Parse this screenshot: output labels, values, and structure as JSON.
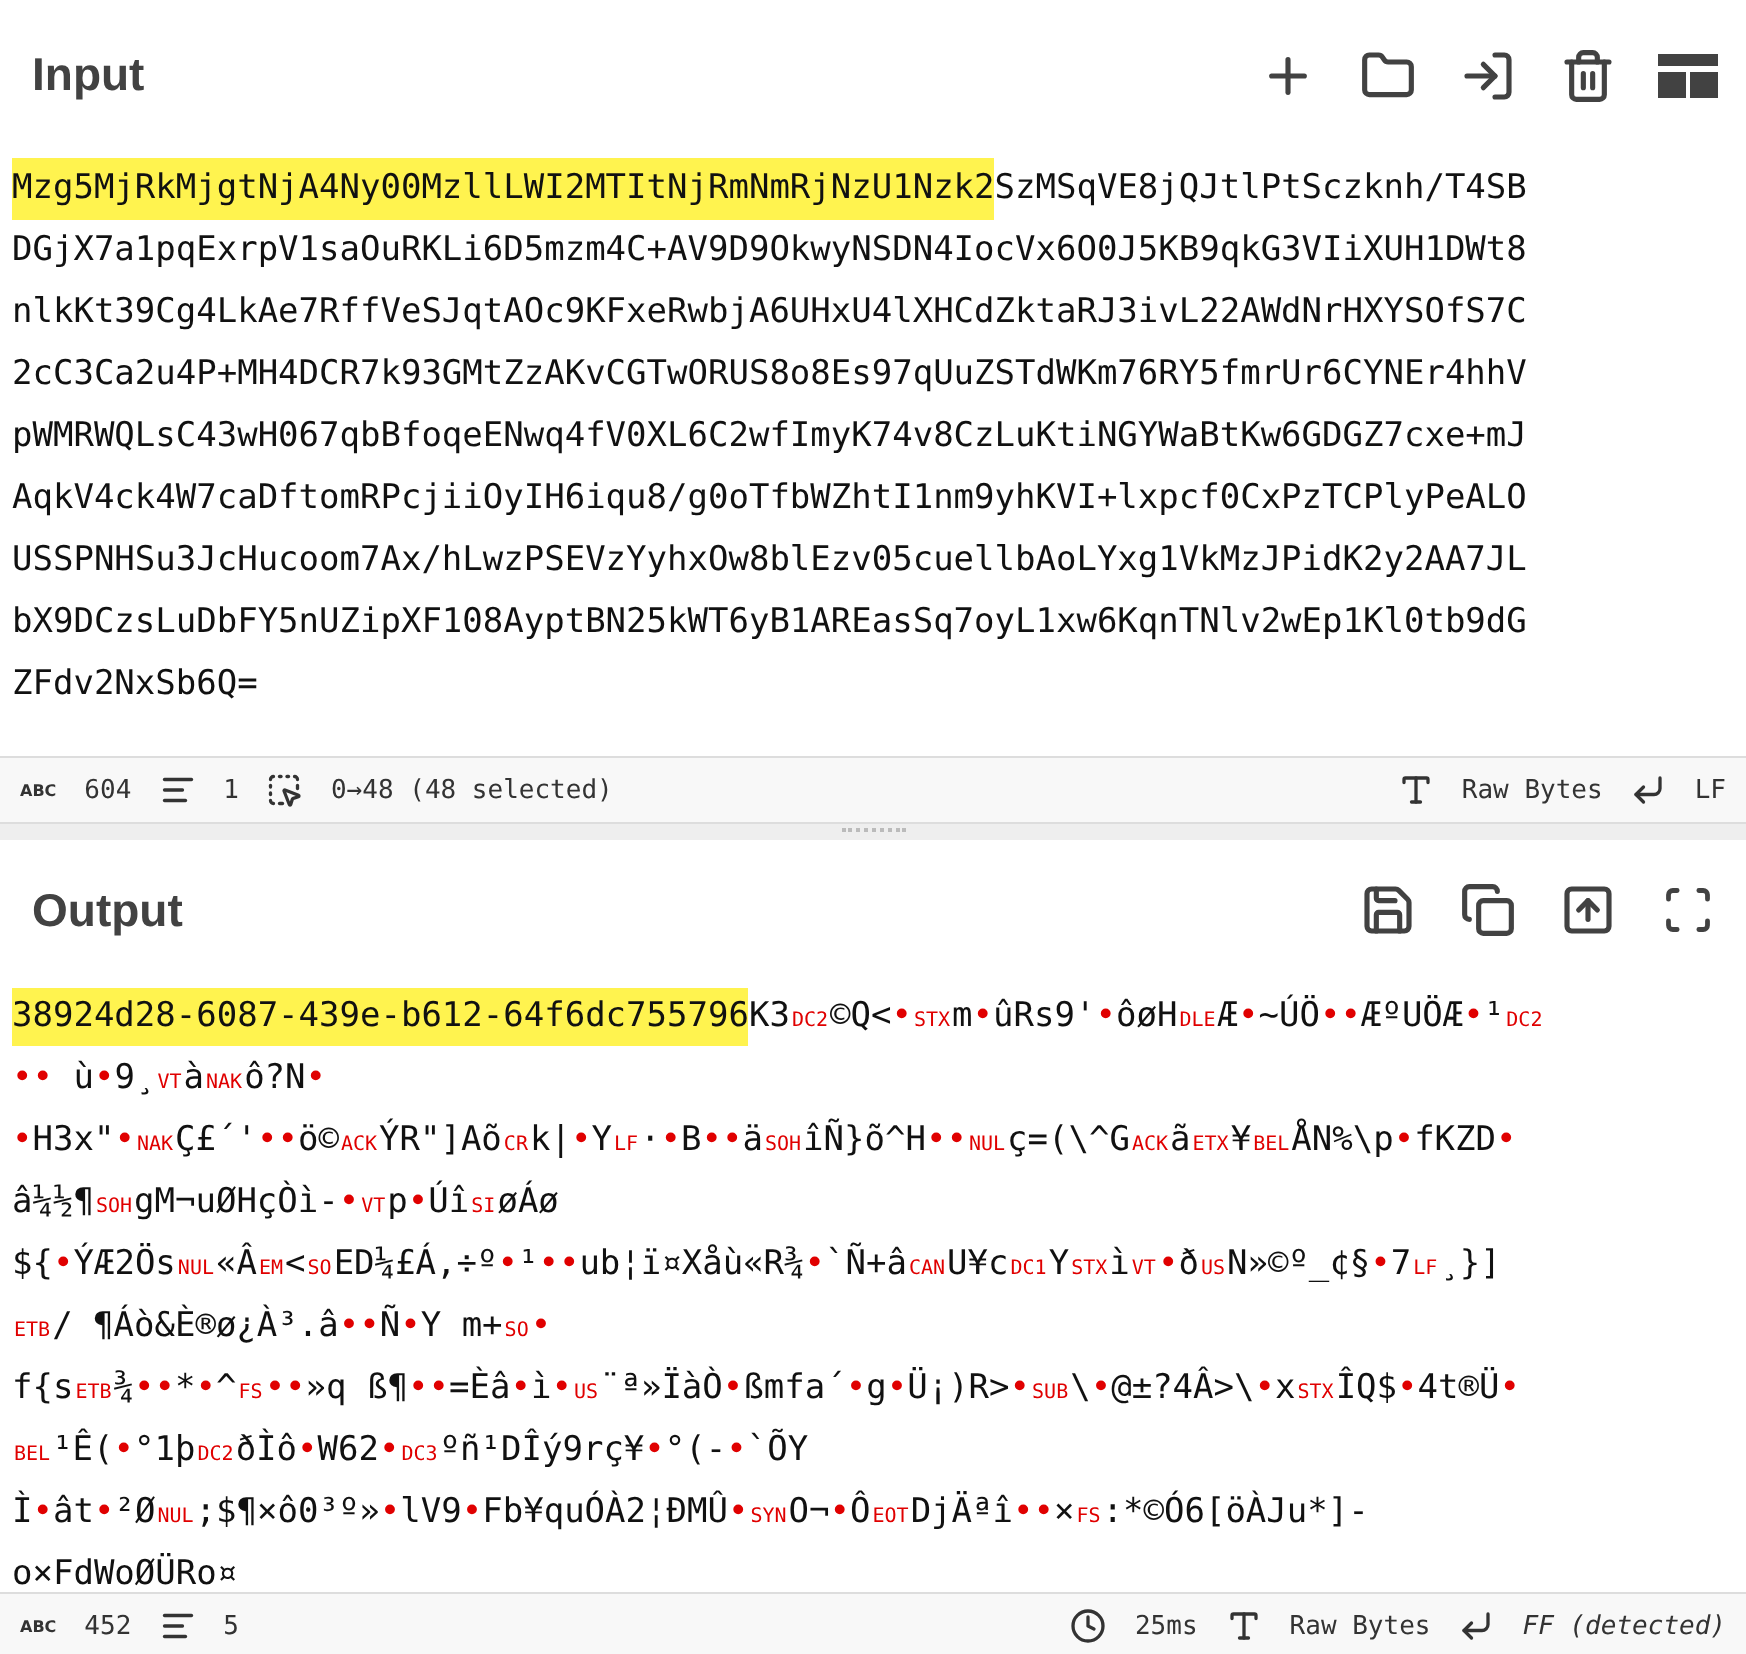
{
  "input": {
    "title": "Input",
    "selected_text": "Mzg5MjRkMjgtNjA4Ny00MzllLWI2MTItNjRmNmRjNzU1Nzk2",
    "lines": [
      "SzMSqVE8jQJtlPtSczknh/T4SB",
      "DGjX7a1pqExrpV1saOuRKLi6D5mzm4C+AV9D9OkwyNSDN4IocVx6O0J5KB9qkG3VIiXUH1DWt8",
      "nlkKt39Cg4LkAe7RffVeSJqtAOc9KFxeRwbjA6UHxU4lXHCdZktaRJ3ivL22AWdNrHXYSOfS7C",
      "2cC3Ca2u4P+MH4DCR7k93GMtZzAKvCGTwORUS8o8Es97qUuZSTdWKm76RY5fmrUr6CYNEr4hhV",
      "pWMRWQLsC43wH067qbBfoqeENwq4fV0XL6C2wfImyK74v8CzLuKtiNGYWaBtKw6GDGZ7cxe+mJ",
      "AqkV4ck4W7caDftomRPcjiiOyIH6iqu8/g0oTfbWZhtI1nm9yhKVI+lxpcf0CxPzTCPlyPeALO",
      "USSPNHSu3JcHucoom7Ax/hLwzPSEVzYyhxOw8blEzv05cuellbAoLYxg1VkMzJPidK2y2AA7JL",
      "bX9DCzsLuDbFY5nUZipXF108AyptBN25kWT6yB1AREasSq7oyL1xw6KqnTNlv2wEp1Kl0tb9dG",
      "ZFdv2NxSb6Q="
    ],
    "status": {
      "length_label": "ABC",
      "length": "604",
      "lines": "1",
      "selection": "0→48 (48 selected)",
      "encoding": "Raw Bytes",
      "eol": "LF"
    }
  },
  "output": {
    "title": "Output",
    "selected_text": "38924d28-6087-439e-b612-64f6dc755796",
    "lines": [
      [
        {
          "kind": "text",
          "text": "K3"
        },
        {
          "kind": "control",
          "text": "DC2"
        },
        {
          "kind": "text",
          "text": "©Q<"
        },
        {
          "kind": "dot",
          "text": "•"
        },
        {
          "kind": "control",
          "text": "STX"
        },
        {
          "kind": "text",
          "text": "m"
        },
        {
          "kind": "dot",
          "text": "•"
        },
        {
          "kind": "text",
          "text": "ûRs9'"
        },
        {
          "kind": "dot",
          "text": "•"
        },
        {
          "kind": "text",
          "text": "ôøH"
        },
        {
          "kind": "control",
          "text": "DLE"
        },
        {
          "kind": "text",
          "text": "Æ"
        },
        {
          "kind": "dot",
          "text": "•"
        },
        {
          "kind": "text",
          "text": "~ÚÖ"
        },
        {
          "kind": "dot",
          "text": "••"
        },
        {
          "kind": "text",
          "text": "ÆºUÖÆ"
        },
        {
          "kind": "dot",
          "text": "•"
        },
        {
          "kind": "text",
          "text": "¹"
        },
        {
          "kind": "control",
          "text": "DC2"
        }
      ],
      [
        {
          "kind": "dot",
          "text": "••"
        },
        {
          "kind": "text",
          "text": " ù"
        },
        {
          "kind": "dot",
          "text": "•"
        },
        {
          "kind": "text",
          "text": "9¸"
        },
        {
          "kind": "control",
          "text": "VT"
        },
        {
          "kind": "text",
          "text": "à"
        },
        {
          "kind": "control",
          "text": "NAK"
        },
        {
          "kind": "text",
          "text": "ô?N"
        },
        {
          "kind": "dot",
          "text": "•"
        }
      ],
      [
        {
          "kind": "dot",
          "text": "•"
        },
        {
          "kind": "text",
          "text": "H3x\""
        },
        {
          "kind": "dot",
          "text": "•"
        },
        {
          "kind": "control",
          "text": "NAK"
        },
        {
          "kind": "text",
          "text": "Ç£´'"
        },
        {
          "kind": "dot",
          "text": "••"
        },
        {
          "kind": "text",
          "text": "ö©"
        },
        {
          "kind": "control",
          "text": "ACK"
        },
        {
          "kind": "text",
          "text": "ÝR\"]Aõ"
        },
        {
          "kind": "control",
          "text": "CR"
        },
        {
          "kind": "text",
          "text": "k|"
        },
        {
          "kind": "dot",
          "text": "•"
        },
        {
          "kind": "text",
          "text": "Y"
        },
        {
          "kind": "control",
          "text": "LF"
        },
        {
          "kind": "text",
          "text": "·"
        },
        {
          "kind": "dot",
          "text": "•"
        },
        {
          "kind": "text",
          "text": "B"
        },
        {
          "kind": "dot",
          "text": "••"
        },
        {
          "kind": "text",
          "text": "ä"
        },
        {
          "kind": "control",
          "text": "SOH"
        },
        {
          "kind": "text",
          "text": "îÑ}õ^H"
        },
        {
          "kind": "dot",
          "text": "••"
        },
        {
          "kind": "control",
          "text": "NUL"
        },
        {
          "kind": "text",
          "text": "ç=(\\^G"
        },
        {
          "kind": "control",
          "text": "ACK"
        },
        {
          "kind": "text",
          "text": "ã"
        },
        {
          "kind": "control",
          "text": "ETX"
        },
        {
          "kind": "text",
          "text": "¥"
        },
        {
          "kind": "control",
          "text": "BEL"
        },
        {
          "kind": "text",
          "text": "ÅN%\\p"
        },
        {
          "kind": "dot",
          "text": "•"
        },
        {
          "kind": "text",
          "text": "fKZD"
        },
        {
          "kind": "dot",
          "text": "•"
        }
      ],
      [
        {
          "kind": "text",
          "text": "â¼½¶"
        },
        {
          "kind": "control",
          "text": "SOH"
        },
        {
          "kind": "text",
          "text": "gM¬uØHçÒì-"
        },
        {
          "kind": "dot",
          "text": "•"
        },
        {
          "kind": "control",
          "text": "VT"
        },
        {
          "kind": "text",
          "text": "p"
        },
        {
          "kind": "dot",
          "text": "•"
        },
        {
          "kind": "text",
          "text": "Úî"
        },
        {
          "kind": "control",
          "text": "SI"
        },
        {
          "kind": "text",
          "text": "øÁø"
        }
      ],
      [
        {
          "kind": "text",
          "text": "${"
        },
        {
          "kind": "dot",
          "text": "•"
        },
        {
          "kind": "text",
          "text": "ÝÆ2Ös"
        },
        {
          "kind": "control",
          "text": "NUL"
        },
        {
          "kind": "text",
          "text": "«Â"
        },
        {
          "kind": "control",
          "text": "EM"
        },
        {
          "kind": "text",
          "text": "<"
        },
        {
          "kind": "control",
          "text": "SO"
        },
        {
          "kind": "text",
          "text": "ED¼£Á,÷º"
        },
        {
          "kind": "dot",
          "text": "•"
        },
        {
          "kind": "text",
          "text": "¹"
        },
        {
          "kind": "dot",
          "text": "••"
        },
        {
          "kind": "text",
          "text": "ub¦ï¤Xåù«R¾"
        },
        {
          "kind": "dot",
          "text": "•"
        },
        {
          "kind": "text",
          "text": "`Ñ+â"
        },
        {
          "kind": "control",
          "text": "CAN"
        },
        {
          "kind": "text",
          "text": "U¥c"
        },
        {
          "kind": "control",
          "text": "DC1"
        },
        {
          "kind": "text",
          "text": "Y"
        },
        {
          "kind": "control",
          "text": "STX"
        },
        {
          "kind": "text",
          "text": "ì"
        },
        {
          "kind": "control",
          "text": "VT"
        },
        {
          "kind": "dot",
          "text": "•"
        },
        {
          "kind": "text",
          "text": "ð"
        },
        {
          "kind": "control",
          "text": "US"
        },
        {
          "kind": "text",
          "text": "N»©º_¢§"
        },
        {
          "kind": "dot",
          "text": "•"
        },
        {
          "kind": "text",
          "text": "7"
        },
        {
          "kind": "control",
          "text": "LF"
        },
        {
          "kind": "text",
          "text": "¸}]"
        }
      ],
      [
        {
          "kind": "control",
          "text": "ETB"
        },
        {
          "kind": "text",
          "text": "/ ¶Áò&È®ø¿À³.â"
        },
        {
          "kind": "dot",
          "text": "••"
        },
        {
          "kind": "text",
          "text": "Ñ"
        },
        {
          "kind": "dot",
          "text": "•"
        },
        {
          "kind": "text",
          "text": "Y m+"
        },
        {
          "kind": "control",
          "text": "SO"
        },
        {
          "kind": "dot",
          "text": "•"
        }
      ],
      [
        {
          "kind": "text",
          "text": "f{s"
        },
        {
          "kind": "control",
          "text": "ETB"
        },
        {
          "kind": "text",
          "text": "¾"
        },
        {
          "kind": "dot",
          "text": "••"
        },
        {
          "kind": "text",
          "text": "*"
        },
        {
          "kind": "dot",
          "text": "•"
        },
        {
          "kind": "text",
          "text": "^"
        },
        {
          "kind": "control",
          "text": "FS"
        },
        {
          "kind": "dot",
          "text": "••"
        },
        {
          "kind": "text",
          "text": "»q ß¶"
        },
        {
          "kind": "dot",
          "text": "••"
        },
        {
          "kind": "text",
          "text": "=Èâ"
        },
        {
          "kind": "dot",
          "text": "•"
        },
        {
          "kind": "text",
          "text": "ì"
        },
        {
          "kind": "dot",
          "text": "•"
        },
        {
          "kind": "control",
          "text": "US"
        },
        {
          "kind": "text",
          "text": "¨ª»ÏàÒ"
        },
        {
          "kind": "dot",
          "text": "•"
        },
        {
          "kind": "text",
          "text": "ßmfa´"
        },
        {
          "kind": "dot",
          "text": "•"
        },
        {
          "kind": "text",
          "text": "g"
        },
        {
          "kind": "dot",
          "text": "•"
        },
        {
          "kind": "text",
          "text": "Ü¡)R>"
        },
        {
          "kind": "dot",
          "text": "•"
        },
        {
          "kind": "control",
          "text": "SUB"
        },
        {
          "kind": "text",
          "text": "\\"
        },
        {
          "kind": "dot",
          "text": "•"
        },
        {
          "kind": "text",
          "text": "@±?4Â>\\"
        },
        {
          "kind": "dot",
          "text": "•"
        },
        {
          "kind": "text",
          "text": "x"
        },
        {
          "kind": "control",
          "text": "STX"
        },
        {
          "kind": "text",
          "text": "ÎQ$"
        },
        {
          "kind": "dot",
          "text": "•"
        },
        {
          "kind": "text",
          "text": "4t®Ü"
        },
        {
          "kind": "dot",
          "text": "•"
        }
      ],
      [
        {
          "kind": "control",
          "text": "BEL"
        },
        {
          "kind": "text",
          "text": "¹Ê("
        },
        {
          "kind": "dot",
          "text": "•"
        },
        {
          "kind": "text",
          "text": "°1þ"
        },
        {
          "kind": "control",
          "text": "DC2"
        },
        {
          "kind": "text",
          "text": "ðÌô"
        },
        {
          "kind": "dot",
          "text": "•"
        },
        {
          "kind": "text",
          "text": "W62"
        },
        {
          "kind": "dot",
          "text": "•"
        },
        {
          "kind": "control",
          "text": "DC3"
        },
        {
          "kind": "text",
          "text": "ºñ¹DÎý9rç¥"
        },
        {
          "kind": "dot",
          "text": "•"
        },
        {
          "kind": "text",
          "text": "°(-"
        },
        {
          "kind": "dot",
          "text": "•"
        },
        {
          "kind": "text",
          "text": "`ÕY"
        }
      ],
      [
        {
          "kind": "text",
          "text": "Ì"
        },
        {
          "kind": "dot",
          "text": "•"
        },
        {
          "kind": "text",
          "text": "ât"
        },
        {
          "kind": "dot",
          "text": "•"
        },
        {
          "kind": "text",
          "text": "²Ø"
        },
        {
          "kind": "control",
          "text": "NUL"
        },
        {
          "kind": "text",
          "text": ";$¶×ô0³º»"
        },
        {
          "kind": "dot",
          "text": "•"
        },
        {
          "kind": "text",
          "text": "lV9"
        },
        {
          "kind": "dot",
          "text": "•"
        },
        {
          "kind": "text",
          "text": "Fb¥quÓÀ2¦ÐMÛ"
        },
        {
          "kind": "dot",
          "text": "•"
        },
        {
          "kind": "control",
          "text": "SYN"
        },
        {
          "kind": "text",
          "text": "O¬"
        },
        {
          "kind": "dot",
          "text": "•"
        },
        {
          "kind": "text",
          "text": "Ô"
        },
        {
          "kind": "control",
          "text": "EOT"
        },
        {
          "kind": "text",
          "text": "DjÄªî"
        },
        {
          "kind": "dot",
          "text": "••"
        },
        {
          "kind": "text",
          "text": "×"
        },
        {
          "kind": "control",
          "text": "FS"
        },
        {
          "kind": "text",
          "text": ":*©Ó6[öÀJu*]-"
        }
      ],
      [
        {
          "kind": "text",
          "text": "o×FdWoØÜRo¤"
        }
      ]
    ],
    "status": {
      "length_label": "ABC",
      "length": "452",
      "lines": "5",
      "time": "25ms",
      "encoding": "Raw Bytes",
      "eol": "FF (detected)"
    }
  }
}
